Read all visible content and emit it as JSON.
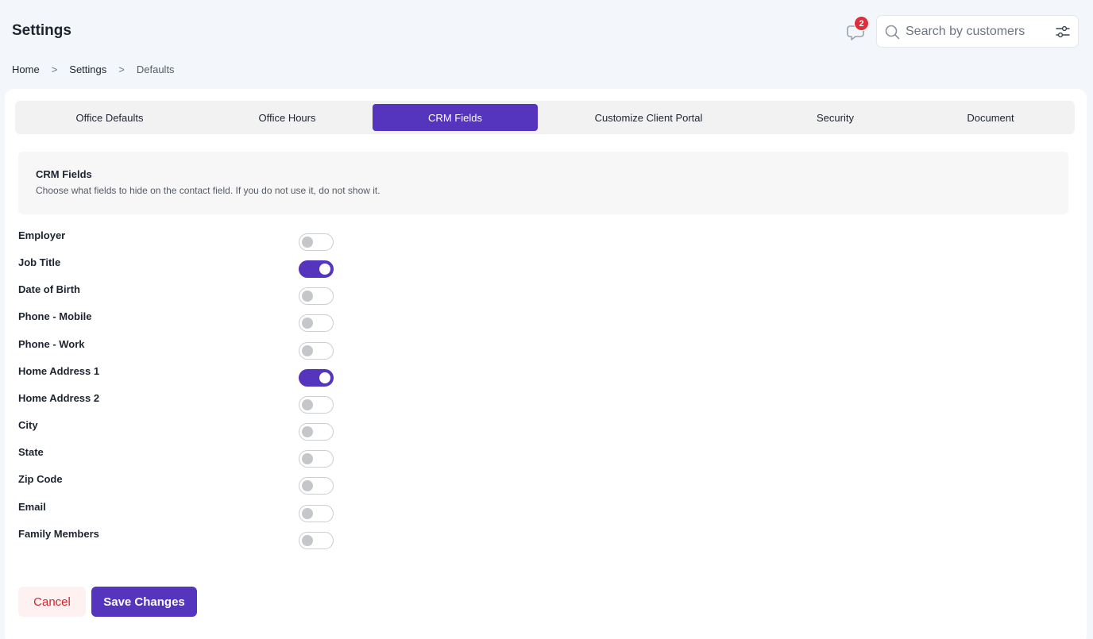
{
  "header": {
    "title": "Settings",
    "notification_count": "2",
    "search": {
      "placeholder": "Search by customers",
      "value": ""
    }
  },
  "breadcrumb": {
    "items": [
      "Home",
      "Settings",
      "Defaults"
    ],
    "separator": ">"
  },
  "tabs": [
    {
      "label": "Office Defaults"
    },
    {
      "label": "Office Hours"
    },
    {
      "label": "CRM Fields",
      "active": true
    },
    {
      "label": "Customize Client Portal"
    },
    {
      "label": "Security"
    },
    {
      "label": "Document"
    }
  ],
  "section": {
    "title": "CRM Fields",
    "description": "Choose what fields to hide on the contact field. If you do not use it, do not show it."
  },
  "fields": [
    {
      "label": "Employer",
      "enabled": false
    },
    {
      "label": "Job Title",
      "enabled": true
    },
    {
      "label": "Date of Birth",
      "enabled": false
    },
    {
      "label": "Phone - Mobile",
      "enabled": false
    },
    {
      "label": "Phone - Work",
      "enabled": false
    },
    {
      "label": "Home Address 1",
      "enabled": true
    },
    {
      "label": "Home Address 2",
      "enabled": false
    },
    {
      "label": "City",
      "enabled": false
    },
    {
      "label": "State",
      "enabled": false
    },
    {
      "label": "Zip Code",
      "enabled": false
    },
    {
      "label": "Email",
      "enabled": false
    },
    {
      "label": "Family Members",
      "enabled": false
    }
  ],
  "actions": {
    "cancel_label": "Cancel",
    "save_label": "Save Changes"
  },
  "colors": {
    "accent": "#5535be",
    "badge": "#e02d3c",
    "cancel_text": "#d8232f",
    "cancel_bg": "#fdf1f2"
  },
  "icons": {
    "notification": "chat-bubble-icon",
    "search": "search-icon",
    "filter": "sliders-icon"
  }
}
